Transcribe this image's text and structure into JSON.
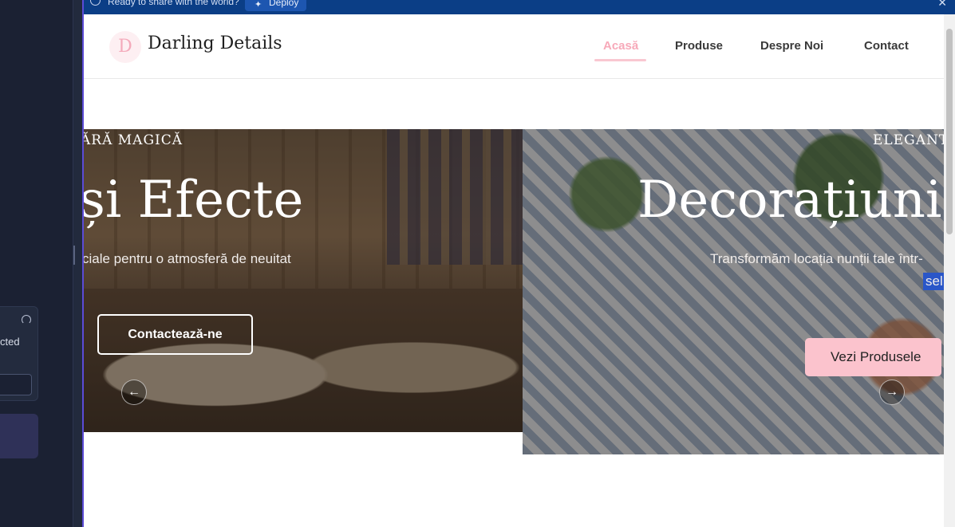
{
  "deploy_bar": {
    "message": "Ready to share with the world?",
    "deploy_label": "Deploy",
    "info_icon": "info-icon",
    "close_icon": "close-icon"
  },
  "left_panel": {
    "card_text": "cted",
    "gauge_icon": "gauge-icon"
  },
  "site": {
    "brand": {
      "initial": "D",
      "name": "Darling Details"
    },
    "nav": [
      {
        "label": "Acasă",
        "active": true
      },
      {
        "label": "Produse",
        "active": false
      },
      {
        "label": "Despre Noi",
        "active": false
      },
      {
        "label": "Contact",
        "active": false
      }
    ],
    "slides": {
      "left": {
        "eyebrow": "ĂRĂ MAGICĂ",
        "title": "și Efecte",
        "subtitle": "ciale pentru o atmosferă de neuitat",
        "button": "Contactează-ne",
        "arrow_icon": "arrow-left-icon"
      },
      "right": {
        "eyebrow": "ELEGANT",
        "title": "Decorațiuni",
        "subtitle": "Transformăm locația nunții tale într-",
        "selected_fragment": "sel",
        "button": "Vezi Produsele",
        "arrow_icon": "arrow-right-icon"
      }
    }
  },
  "colors": {
    "accent_pink": "#f7a9b9",
    "button_pink": "#fbc3cd",
    "deploy_bar": "#0b3e86",
    "editor_bg": "#1b2133"
  }
}
